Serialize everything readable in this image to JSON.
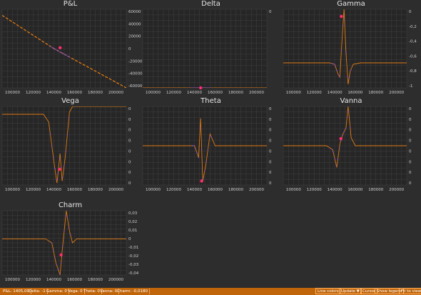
{
  "colors": {
    "background": "#2d2d2d",
    "plot_bg": "#262626",
    "grid": "#474747",
    "curve": "#e07a12",
    "dots": "#7a4ab8",
    "marker": "#ff2d6f",
    "statusbar": "#c0650a"
  },
  "panels": [
    {
      "title": "P&L",
      "xticks": [
        "100000",
        "120000",
        "140000",
        "160000",
        "180000",
        "200000"
      ],
      "yticks": [
        "60000",
        "40000",
        "20000",
        "0",
        "-20000",
        "-40000",
        "-60000"
      ]
    },
    {
      "title": "Delta",
      "xticks": [
        "100000",
        "120000",
        "140000",
        "160000",
        "180000",
        "200000"
      ],
      "yticks": [
        "0",
        "",
        "",
        "",
        "",
        "",
        "",
        "",
        "",
        "",
        ""
      ]
    },
    {
      "title": "Gamma",
      "xticks": [
        "100000",
        "120000",
        "140000",
        "160000",
        "180000",
        "200000"
      ],
      "yticks": [
        "0",
        "-0,2",
        "-0,4",
        "-0,6",
        "-0,8",
        "-1"
      ]
    },
    {
      "title": "Vega",
      "xticks": [
        "100000",
        "120000",
        "140000",
        "160000",
        "180000",
        "200000"
      ],
      "yticks": [
        "0",
        "0",
        "0",
        "0",
        "0",
        "0",
        "0",
        "0"
      ]
    },
    {
      "title": "Theta",
      "xticks": [
        "100000",
        "120000",
        "140000",
        "160000",
        "180000",
        "200000"
      ],
      "yticks": [
        "0",
        "0",
        "0",
        "0",
        "0",
        "0",
        "0",
        "0"
      ]
    },
    {
      "title": "Vanna",
      "xticks": [
        "100000",
        "120000",
        "140000",
        "160000",
        "180000",
        "200000"
      ],
      "yticks": [
        "0",
        "0",
        "0",
        "0",
        "0",
        "0",
        "0",
        "0"
      ]
    },
    {
      "title": "Charm",
      "xticks": [
        "100000",
        "120000",
        "140000",
        "160000",
        "180000",
        "200000"
      ],
      "yticks": [
        "0,03",
        "0,02",
        "0,01",
        "0",
        "-0,01",
        "-0,02",
        "-0,03",
        "-0,04"
      ]
    }
  ],
  "status": {
    "items": [
      "P&L: 1405,00",
      "Delta: -1",
      "Gamma: 0",
      "Vega: 0",
      "Theta: 0",
      "Vanna: 0",
      "Charm: -0,0180"
    ],
    "buttons": {
      "line_colors": "Line colors",
      "update": "Update ▼",
      "cursor": "Cursor",
      "show_legend": "Show legend",
      "fit_to_view": "Fit to view"
    }
  },
  "chart_data": [
    {
      "type": "line",
      "title": "P&L",
      "xlim": [
        90000,
        210000
      ],
      "ylim": [
        -65000,
        65000
      ],
      "x": [
        90000,
        140000,
        210000
      ],
      "values": [
        55000,
        0,
        -65000
      ],
      "marker": {
        "x": 146000,
        "y": 1405
      }
    },
    {
      "type": "line",
      "title": "Delta",
      "xlim": [
        90000,
        210000
      ],
      "ylim": [
        -1,
        0
      ],
      "x": [
        90000,
        210000
      ],
      "values": [
        -1,
        -1
      ],
      "marker": {
        "x": 146000,
        "y": -1
      }
    },
    {
      "type": "line",
      "title": "Gamma",
      "xlim": [
        90000,
        210000
      ],
      "ylim": [
        -1.05,
        0.05
      ],
      "x": [
        90000,
        135000,
        140000,
        143000,
        145000,
        147000,
        149000,
        151000,
        153000,
        155000,
        158000,
        165000,
        210000
      ],
      "values": [
        -0.7,
        -0.7,
        -0.72,
        -0.85,
        -0.9,
        -0.4,
        0.05,
        -0.55,
        -1.0,
        -0.82,
        -0.72,
        -0.7,
        -0.7
      ],
      "marker": {
        "x": 146500,
        "y": -0.05
      }
    },
    {
      "type": "line",
      "title": "Vega",
      "xlim": [
        90000,
        210000
      ],
      "ylim": [
        -1,
        1
      ],
      "x": [
        90000,
        130000,
        135000,
        140000,
        143000,
        146000,
        148000,
        151000,
        155000,
        158000,
        210000
      ],
      "values": [
        0.8,
        0.8,
        0.6,
        -0.4,
        -0.95,
        -0.2,
        -0.9,
        -0.3,
        0.85,
        1,
        1
      ],
      "marker": {
        "x": 145500,
        "y": -0.6
      }
    },
    {
      "type": "line",
      "title": "Theta",
      "xlim": [
        90000,
        210000
      ],
      "ylim": [
        -1,
        1
      ],
      "x": [
        90000,
        135000,
        140000,
        144000,
        146000,
        148000,
        151000,
        155000,
        160000,
        210000
      ],
      "values": [
        0,
        0,
        0,
        -0.3,
        0.7,
        -0.9,
        -0.5,
        0.3,
        0,
        0
      ],
      "marker": {
        "x": 147000,
        "y": -0.9
      }
    },
    {
      "type": "line",
      "title": "Vanna",
      "xlim": [
        90000,
        210000
      ],
      "ylim": [
        -1,
        1
      ],
      "x": [
        90000,
        132000,
        138000,
        142000,
        145000,
        148000,
        151000,
        153000,
        156000,
        160000,
        210000
      ],
      "values": [
        0,
        0,
        -0.1,
        -0.55,
        0.05,
        0.3,
        0.45,
        1.0,
        0.2,
        0,
        0
      ],
      "marker": {
        "x": 146000,
        "y": 0.18
      }
    },
    {
      "type": "line",
      "title": "Charm",
      "xlim": [
        90000,
        210000
      ],
      "ylim": [
        -0.045,
        0.035
      ],
      "x": [
        90000,
        132000,
        138000,
        142000,
        146000,
        148000,
        152000,
        155000,
        158000,
        162000,
        210000
      ],
      "values": [
        0,
        0,
        -0.005,
        -0.03,
        -0.045,
        -0.015,
        0.035,
        0.01,
        -0.005,
        0,
        0
      ],
      "marker": {
        "x": 147000,
        "y": -0.02
      }
    }
  ]
}
